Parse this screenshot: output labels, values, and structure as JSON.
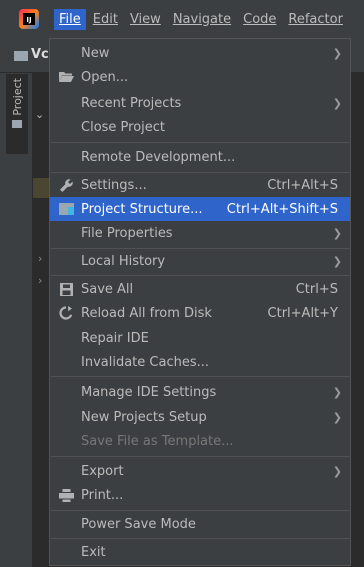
{
  "menubar": {
    "items": [
      {
        "label": "File",
        "active": true
      },
      {
        "label": "Edit"
      },
      {
        "label": "View"
      },
      {
        "label": "Navigate"
      },
      {
        "label": "Code"
      },
      {
        "label": "Refactor"
      }
    ]
  },
  "toolbar": {
    "project_label": "Vc"
  },
  "sidebar": {
    "project_tab_label": "Project"
  },
  "file_menu": {
    "new": "New",
    "open": "Open...",
    "recent_projects": "Recent Projects",
    "close_project": "Close Project",
    "remote_development": "Remote Development...",
    "settings": "Settings...",
    "settings_shortcut": "Ctrl+Alt+S",
    "project_structure": "Project Structure...",
    "project_structure_shortcut": "Ctrl+Alt+Shift+S",
    "file_properties": "File Properties",
    "local_history": "Local History",
    "save_all": "Save All",
    "save_all_shortcut": "Ctrl+S",
    "reload_all": "Reload All from Disk",
    "reload_all_shortcut": "Ctrl+Alt+Y",
    "repair_ide": "Repair IDE",
    "invalidate_caches": "Invalidate Caches...",
    "manage_ide_settings": "Manage IDE Settings",
    "new_projects_setup": "New Projects Setup",
    "save_file_as_template": "Save File as Template...",
    "export": "Export",
    "print": "Print...",
    "power_save_mode": "Power Save Mode",
    "exit": "Exit"
  },
  "colors": {
    "menu_bg": "#3c3f41",
    "highlight": "#2f65ca",
    "text": "#bbbbbb",
    "disabled_text": "#777777"
  }
}
